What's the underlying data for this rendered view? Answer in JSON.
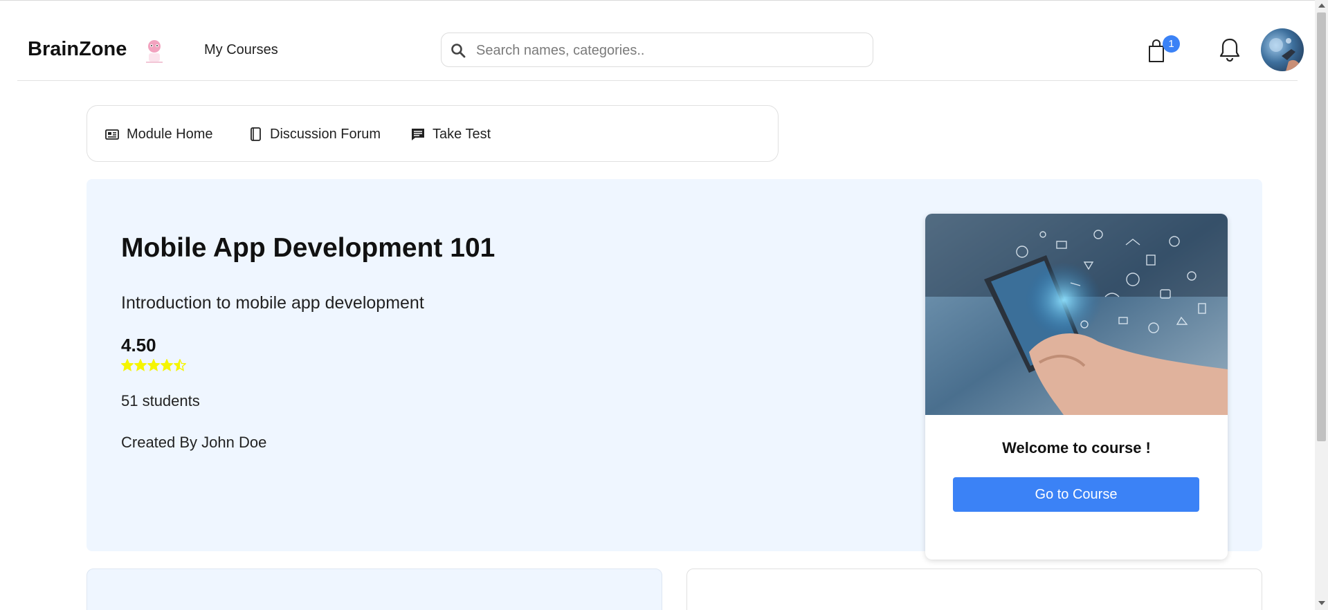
{
  "header": {
    "brand": "BrainZone",
    "nav_my_courses": "My Courses",
    "search_placeholder": "Search names, categories..",
    "cart_count": "1"
  },
  "module_tabs": [
    {
      "label": "Module Home",
      "icon": "newspaper-icon"
    },
    {
      "label": "Discussion Forum",
      "icon": "notebook-icon"
    },
    {
      "label": "Take Test",
      "icon": "message-square-icon"
    }
  ],
  "course": {
    "title": "Mobile App Development 101",
    "subtitle": "Introduction to mobile app development",
    "rating": "4.50",
    "rating_stars": 4.5,
    "students": "51 students",
    "created_by": "Created By John Doe"
  },
  "card": {
    "welcome": "Welcome to course !",
    "button_label": "Go to Course"
  },
  "colors": {
    "accent": "#3b82f6",
    "hero_bg": "#eff6ff",
    "star": "#f5f500"
  }
}
